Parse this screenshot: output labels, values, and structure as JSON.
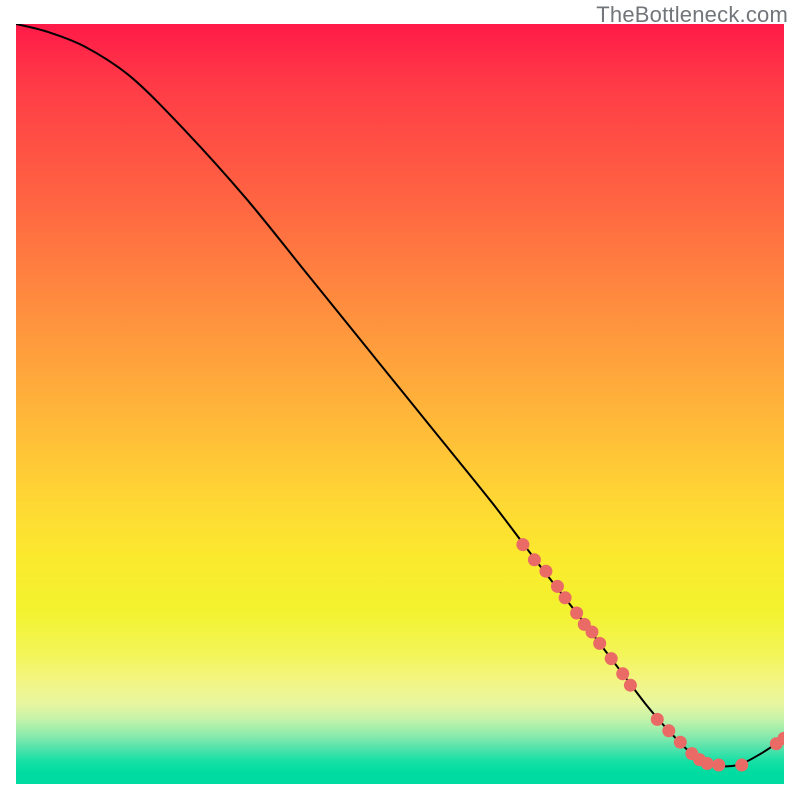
{
  "watermark": "TheBottleneck.com",
  "chart_data": {
    "type": "line",
    "title": "",
    "xlabel": "",
    "ylabel": "",
    "xlim": [
      0,
      100
    ],
    "ylim": [
      0,
      100
    ],
    "x": [
      0,
      4,
      9,
      15,
      22,
      30,
      38,
      46,
      54,
      62,
      68,
      73,
      76,
      79,
      82,
      85,
      88,
      91,
      94,
      97,
      100
    ],
    "values": [
      100,
      99,
      97,
      93,
      86,
      77,
      67,
      57,
      47,
      37,
      29,
      22.5,
      18.5,
      14.5,
      10.5,
      7,
      4,
      2.5,
      2.5,
      4,
      6
    ],
    "highlight_points": {
      "x": [
        66,
        67.5,
        69,
        70.5,
        71.5,
        73,
        74,
        75,
        76,
        77.5,
        79,
        80,
        83.5,
        85,
        86.5,
        88,
        89,
        90,
        91.5,
        94.5,
        99,
        100
      ],
      "y": [
        31.5,
        29.5,
        28,
        26,
        24.5,
        22.5,
        21,
        20,
        18.5,
        16.5,
        14.5,
        13,
        8.5,
        7,
        5.5,
        4,
        3.2,
        2.7,
        2.5,
        2.5,
        5.3,
        6
      ]
    },
    "colors": {
      "line": "#000000",
      "points": "#ea6a65",
      "gradient_top": "#ff1a48",
      "gradient_bottom": "#00dca1"
    }
  }
}
